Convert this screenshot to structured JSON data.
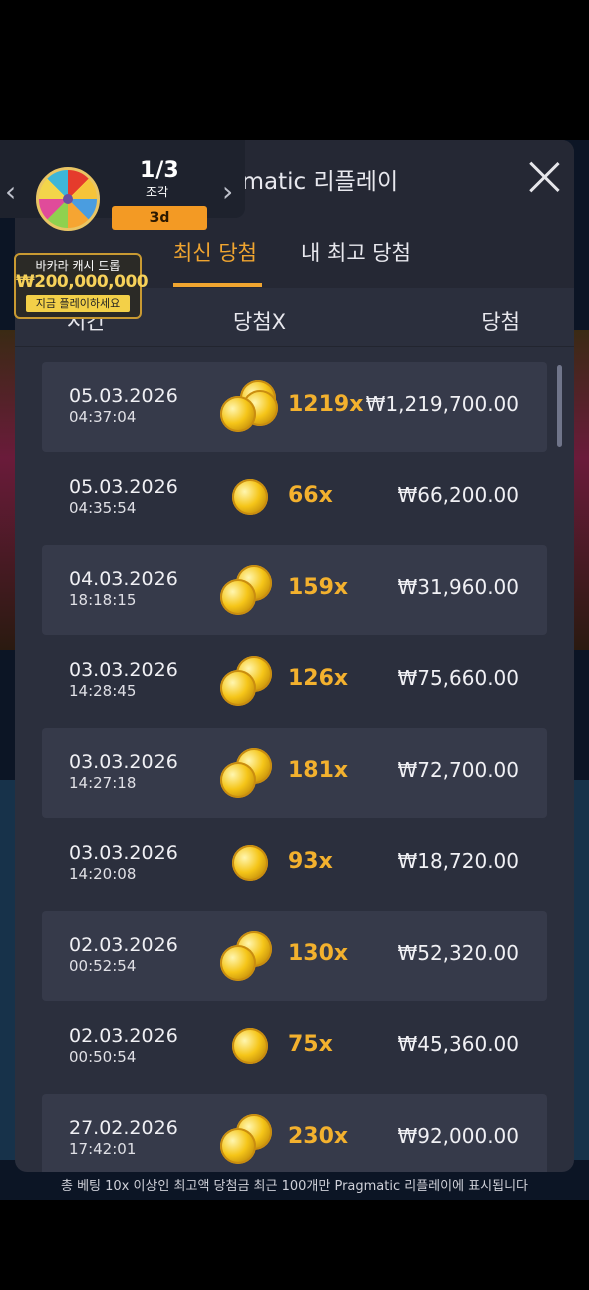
{
  "header": {
    "title": "Pragmatic 리플레이"
  },
  "tabs": [
    {
      "label": "최신 당첨",
      "active": true
    },
    {
      "label": "내 최고 당첨",
      "active": false
    }
  ],
  "columns": {
    "time": "시간",
    "multiplier": "당첨X",
    "win": "당첨"
  },
  "rows": [
    {
      "date": "05.03.2026",
      "time": "04:37:04",
      "multiplier": "1219x",
      "amount": "₩1,219,700.00",
      "coin_icon": "coin-stack-icon"
    },
    {
      "date": "05.03.2026",
      "time": "04:35:54",
      "multiplier": "66x",
      "amount": "₩66,200.00",
      "coin_icon": "coin-icon"
    },
    {
      "date": "04.03.2026",
      "time": "18:18:15",
      "multiplier": "159x",
      "amount": "₩31,960.00",
      "coin_icon": "coins-icon"
    },
    {
      "date": "03.03.2026",
      "time": "14:28:45",
      "multiplier": "126x",
      "amount": "₩75,660.00",
      "coin_icon": "coins-icon"
    },
    {
      "date": "03.03.2026",
      "time": "14:27:18",
      "multiplier": "181x",
      "amount": "₩72,700.00",
      "coin_icon": "coins-icon"
    },
    {
      "date": "03.03.2026",
      "time": "14:20:08",
      "multiplier": "93x",
      "amount": "₩18,720.00",
      "coin_icon": "coin-icon"
    },
    {
      "date": "02.03.2026",
      "time": "00:52:54",
      "multiplier": "130x",
      "amount": "₩52,320.00",
      "coin_icon": "coins-icon"
    },
    {
      "date": "02.03.2026",
      "time": "00:50:54",
      "multiplier": "75x",
      "amount": "₩45,360.00",
      "coin_icon": "coin-icon"
    },
    {
      "date": "27.02.2026",
      "time": "17:42:01",
      "multiplier": "230x",
      "amount": "₩92,000.00",
      "coin_icon": "coins-icon"
    }
  ],
  "footer": {
    "note": "총 베팅 10x 이상인 최고액 당첨금 최근 100개만 Pragmatic 리플레이에 표시됩니다"
  },
  "promo": {
    "pieces_count": "1/3",
    "pieces_label": "조각",
    "timer": "3d",
    "banner_line1": "바카라 캐시 드롭",
    "banner_amount": "₩200,000,000",
    "banner_cta": "지금 플레이하세요"
  },
  "colors": {
    "accent": "#f0a530",
    "panel": "#2b2f3d",
    "multiplier": "#f3b12e"
  }
}
